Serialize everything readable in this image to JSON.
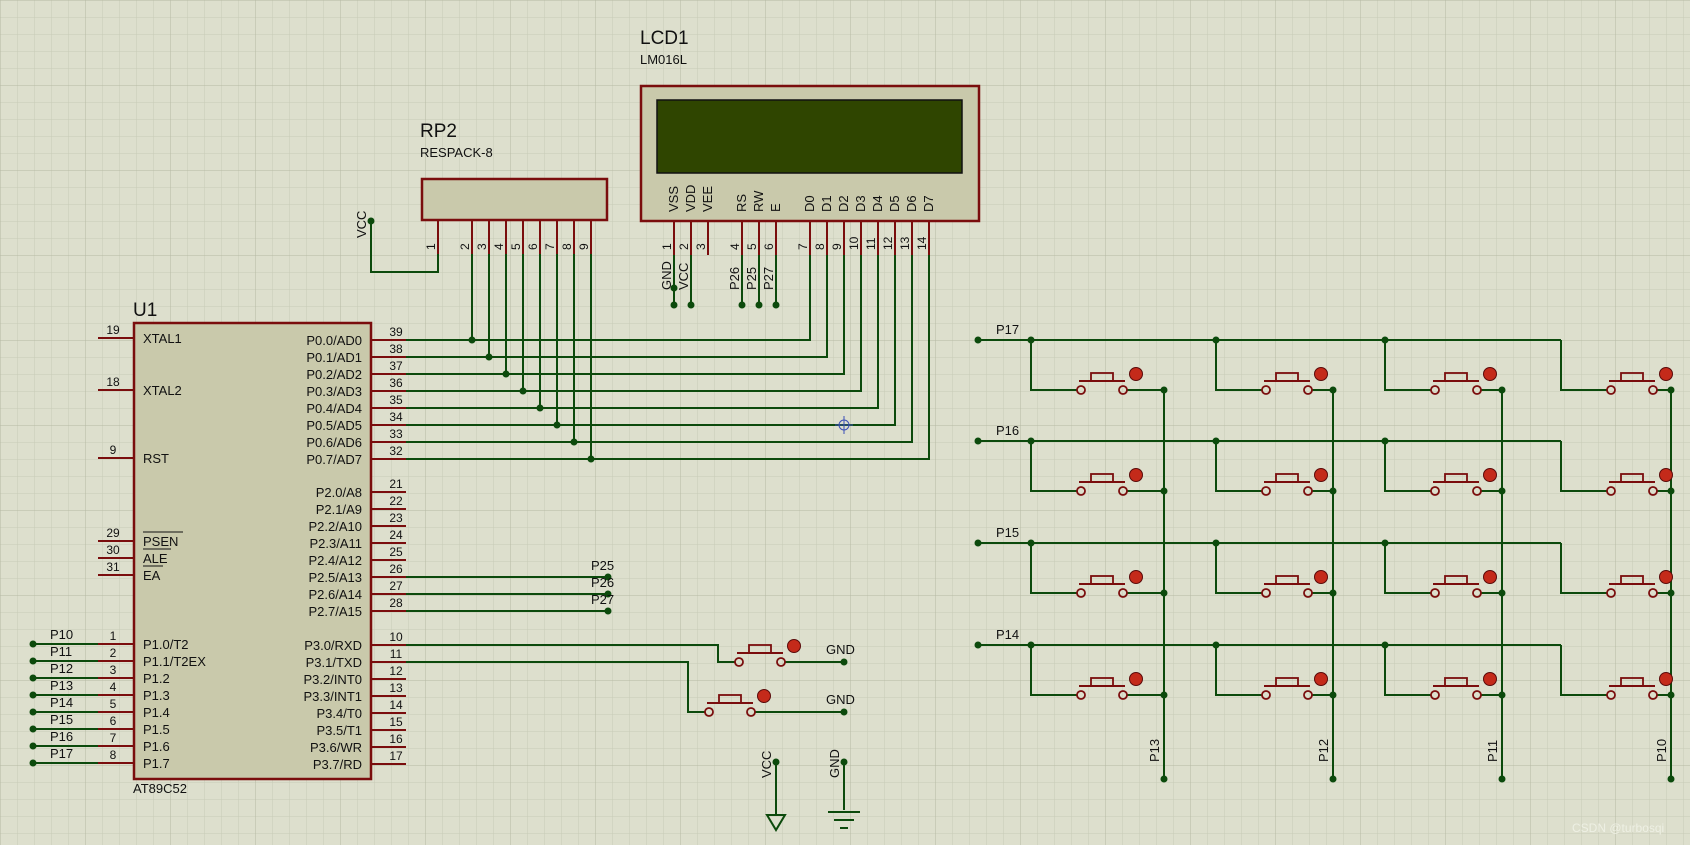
{
  "u1": {
    "ref": "U1",
    "part": "AT89C52",
    "left_pins": [
      {
        "num": "19",
        "name": "XTAL1"
      },
      {
        "num": "18",
        "name": "XTAL2"
      },
      {
        "num": "9",
        "name": "RST"
      },
      {
        "num": "29",
        "name": "PSEN"
      },
      {
        "num": "30",
        "name": "ALE"
      },
      {
        "num": "31",
        "name": "EA"
      },
      {
        "num": "1",
        "name": "P1.0/T2",
        "net": "P10"
      },
      {
        "num": "2",
        "name": "P1.1/T2EX",
        "net": "P11"
      },
      {
        "num": "3",
        "name": "P1.2",
        "net": "P12"
      },
      {
        "num": "4",
        "name": "P1.3",
        "net": "P13"
      },
      {
        "num": "5",
        "name": "P1.4",
        "net": "P14"
      },
      {
        "num": "6",
        "name": "P1.5",
        "net": "P15"
      },
      {
        "num": "7",
        "name": "P1.6",
        "net": "P16"
      },
      {
        "num": "8",
        "name": "P1.7",
        "net": "P17"
      }
    ],
    "right_pins": [
      {
        "num": "39",
        "name": "P0.0/AD0"
      },
      {
        "num": "38",
        "name": "P0.1/AD1"
      },
      {
        "num": "37",
        "name": "P0.2/AD2"
      },
      {
        "num": "36",
        "name": "P0.3/AD3"
      },
      {
        "num": "35",
        "name": "P0.4/AD4"
      },
      {
        "num": "34",
        "name": "P0.5/AD5"
      },
      {
        "num": "33",
        "name": "P0.6/AD6"
      },
      {
        "num": "32",
        "name": "P0.7/AD7"
      },
      {
        "num": "21",
        "name": "P2.0/A8"
      },
      {
        "num": "22",
        "name": "P2.1/A9"
      },
      {
        "num": "23",
        "name": "P2.2/A10"
      },
      {
        "num": "24",
        "name": "P2.3/A11"
      },
      {
        "num": "25",
        "name": "P2.4/A12"
      },
      {
        "num": "26",
        "name": "P2.5/A13",
        "net": "P25"
      },
      {
        "num": "27",
        "name": "P2.6/A14",
        "net": "P26"
      },
      {
        "num": "28",
        "name": "P2.7/A15",
        "net": "P27"
      },
      {
        "num": "10",
        "name": "P3.0/RXD"
      },
      {
        "num": "11",
        "name": "P3.1/TXD"
      },
      {
        "num": "12",
        "name": "P3.2/INT0"
      },
      {
        "num": "13",
        "name": "P3.3/INT1"
      },
      {
        "num": "14",
        "name": "P3.4/T0"
      },
      {
        "num": "15",
        "name": "P3.5/T1"
      },
      {
        "num": "16",
        "name": "P3.6/WR"
      },
      {
        "num": "17",
        "name": "P3.7/RD"
      }
    ]
  },
  "lcd": {
    "ref": "LCD1",
    "part": "LM016L",
    "pins": [
      {
        "num": "1",
        "name": "VSS",
        "net": "GND"
      },
      {
        "num": "2",
        "name": "VDD",
        "net": "VCC"
      },
      {
        "num": "3",
        "name": "VEE"
      },
      {
        "num": "4",
        "name": "RS",
        "net": "P26"
      },
      {
        "num": "5",
        "name": "RW",
        "net": "P25"
      },
      {
        "num": "6",
        "name": "E",
        "net": "P27"
      },
      {
        "num": "7",
        "name": "D0"
      },
      {
        "num": "8",
        "name": "D1"
      },
      {
        "num": "9",
        "name": "D2"
      },
      {
        "num": "10",
        "name": "D3"
      },
      {
        "num": "11",
        "name": "D4"
      },
      {
        "num": "12",
        "name": "D5"
      },
      {
        "num": "13",
        "name": "D6"
      },
      {
        "num": "14",
        "name": "D7"
      }
    ]
  },
  "rp2": {
    "ref": "RP2",
    "part": "RESPACK-8",
    "pins": [
      "1",
      "2",
      "3",
      "4",
      "5",
      "6",
      "7",
      "8",
      "9"
    ],
    "pin1_net": "VCC"
  },
  "keypad": {
    "rows": [
      "P17",
      "P16",
      "P15",
      "P14"
    ],
    "cols": [
      "P13",
      "P12",
      "P11",
      "P10"
    ]
  },
  "buttons_net": "GND",
  "power": {
    "vcc": "VCC",
    "gnd": "GND"
  },
  "watermark": "CSDN @turbosqi",
  "colors": {
    "background": "#dddfcd",
    "grid": "#c3c7b2",
    "body_fill": "#c9c9ab",
    "body_stroke": "#7a0d0d",
    "wire": "#0c4a0c",
    "lcd_screen": "#2f4500",
    "button_red": "#c42a1a"
  }
}
